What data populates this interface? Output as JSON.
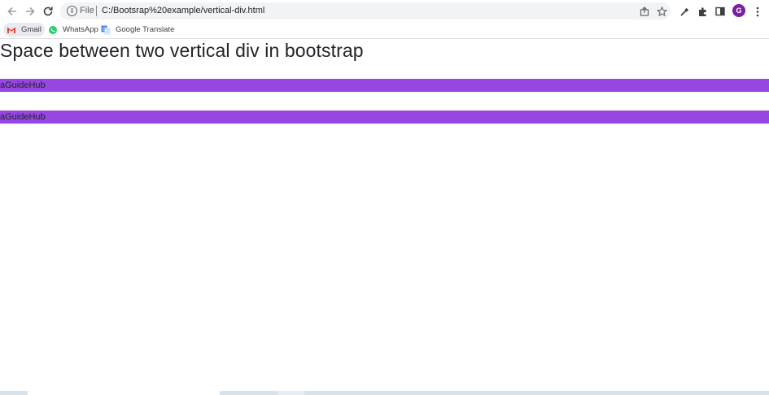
{
  "browser": {
    "scheme_label": "File",
    "url": "C:/Bootsrap%20example/vertical-div.html",
    "profile_initial": "G",
    "bookmarks": [
      {
        "label": "Gmail",
        "icon": "gmail-icon"
      },
      {
        "label": "WhatsApp",
        "icon": "whatsapp-icon"
      },
      {
        "label": "Google Translate",
        "icon": "google-translate-icon"
      }
    ]
  },
  "page": {
    "title": "Space between two vertical div in bootstrap",
    "blocks": [
      {
        "text": "aGuideHub"
      },
      {
        "text": "aGuideHub"
      }
    ]
  },
  "colors": {
    "block_background": "#9745e3",
    "avatar": "#7b1fa2",
    "omnibox": "#f1f3f4"
  }
}
